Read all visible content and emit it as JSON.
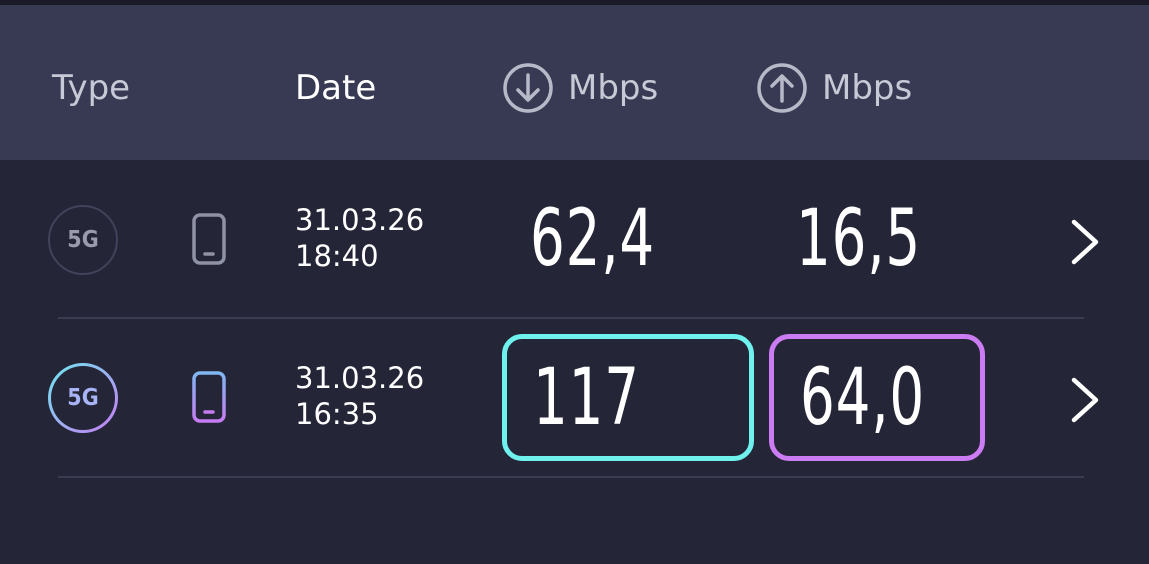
{
  "header": {
    "type_label": "Type",
    "date_label": "Date",
    "download_label": "Mbps",
    "upload_label": "Mbps",
    "download_icon": "arrow-down-circle-icon",
    "upload_icon": "arrow-up-circle-icon"
  },
  "rows": [
    {
      "network": "5G",
      "device_icon": "phone-icon",
      "date": "31.03.26",
      "time": "18:40",
      "download": "62,4",
      "upload": "16,5",
      "highlighted": false
    },
    {
      "network": "5G",
      "device_icon": "phone-icon",
      "date": "31.03.26",
      "time": "16:35",
      "download": "117",
      "upload": "64,0",
      "highlighted": true
    }
  ],
  "colors": {
    "background": "#252538",
    "header": "#373a52",
    "download_accent": "#6ff1ee",
    "upload_accent": "#cc7cf2"
  }
}
